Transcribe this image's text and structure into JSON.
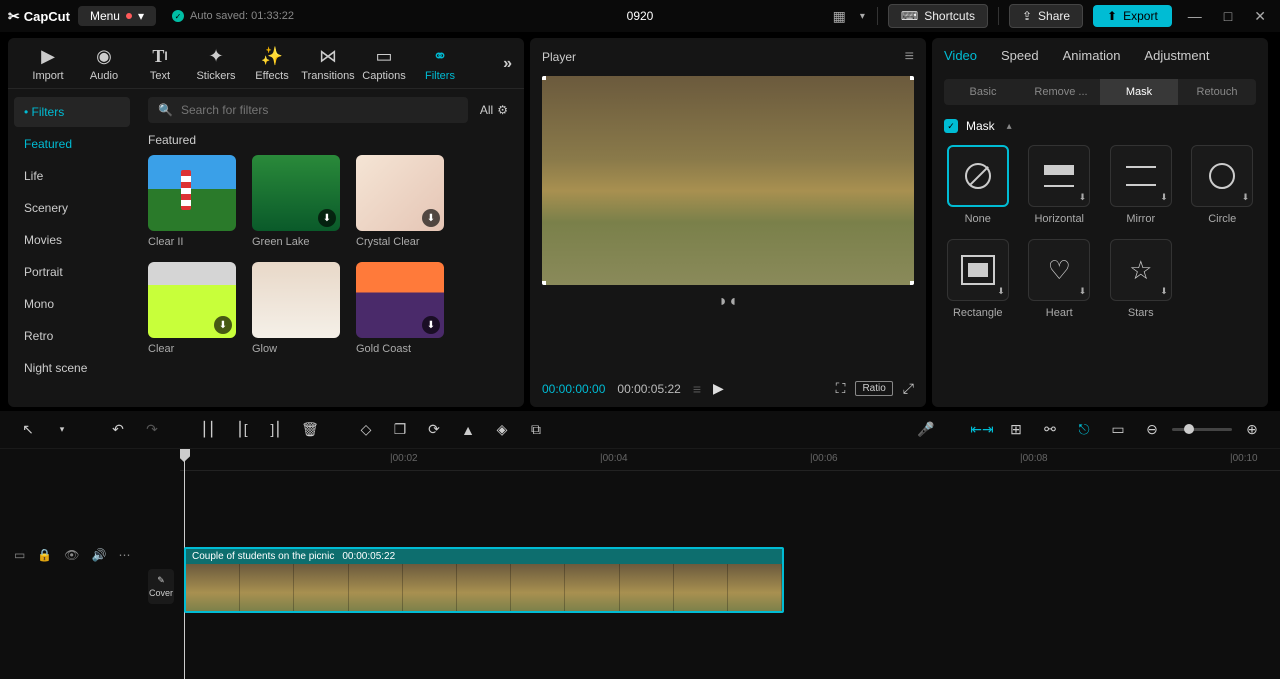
{
  "topbar": {
    "brand": "CapCut",
    "menu": "Menu",
    "autosave": "Auto saved: 01:33:22",
    "projectName": "0920",
    "shortcuts": "Shortcuts",
    "share": "Share",
    "export": "Export"
  },
  "mediaTabs": {
    "items": [
      "Import",
      "Audio",
      "Text",
      "Stickers",
      "Effects",
      "Transitions",
      "Captions",
      "Filters"
    ],
    "active": "Filters"
  },
  "filters": {
    "catsHeader": "Filters",
    "cats": [
      "Featured",
      "Life",
      "Scenery",
      "Movies",
      "Portrait",
      "Mono",
      "Retro",
      "Night scene"
    ],
    "activeCat": "Featured",
    "searchPlaceholder": "Search for filters",
    "allLabel": "All",
    "sectionTitle": "Featured",
    "items": [
      {
        "name": "Clear II",
        "dl": false
      },
      {
        "name": "Green Lake",
        "dl": true
      },
      {
        "name": "Crystal Clear",
        "dl": true
      },
      {
        "name": "Clear",
        "dl": true
      },
      {
        "name": "Glow",
        "dl": false
      },
      {
        "name": "Gold Coast",
        "dl": true
      }
    ]
  },
  "player": {
    "title": "Player",
    "currentTime": "00:00:00:00",
    "duration": "00:00:05:22",
    "ratioLabel": "Ratio"
  },
  "inspector": {
    "tabs": [
      "Video",
      "Speed",
      "Animation",
      "Adjustment"
    ],
    "activeTab": "Video",
    "subtabs": [
      "Basic",
      "Remove ...",
      "Mask",
      "Retouch"
    ],
    "activeSubtab": "Mask",
    "maskLabel": "Mask",
    "masks": [
      {
        "name": "None",
        "dl": false,
        "selected": true
      },
      {
        "name": "Horizontal",
        "dl": true,
        "selected": false
      },
      {
        "name": "Mirror",
        "dl": true,
        "selected": false
      },
      {
        "name": "Circle",
        "dl": true,
        "selected": false
      },
      {
        "name": "Rectangle",
        "dl": true,
        "selected": false
      },
      {
        "name": "Heart",
        "dl": true,
        "selected": false
      },
      {
        "name": "Stars",
        "dl": true,
        "selected": false
      }
    ]
  },
  "timeline": {
    "ticks": [
      "|00:02",
      "|00:04",
      "|00:06",
      "|00:08",
      "|00:10"
    ],
    "coverLabel": "Cover",
    "clipTitle": "Couple of students on the picnic",
    "clipDuration": "00:00:05:22"
  }
}
